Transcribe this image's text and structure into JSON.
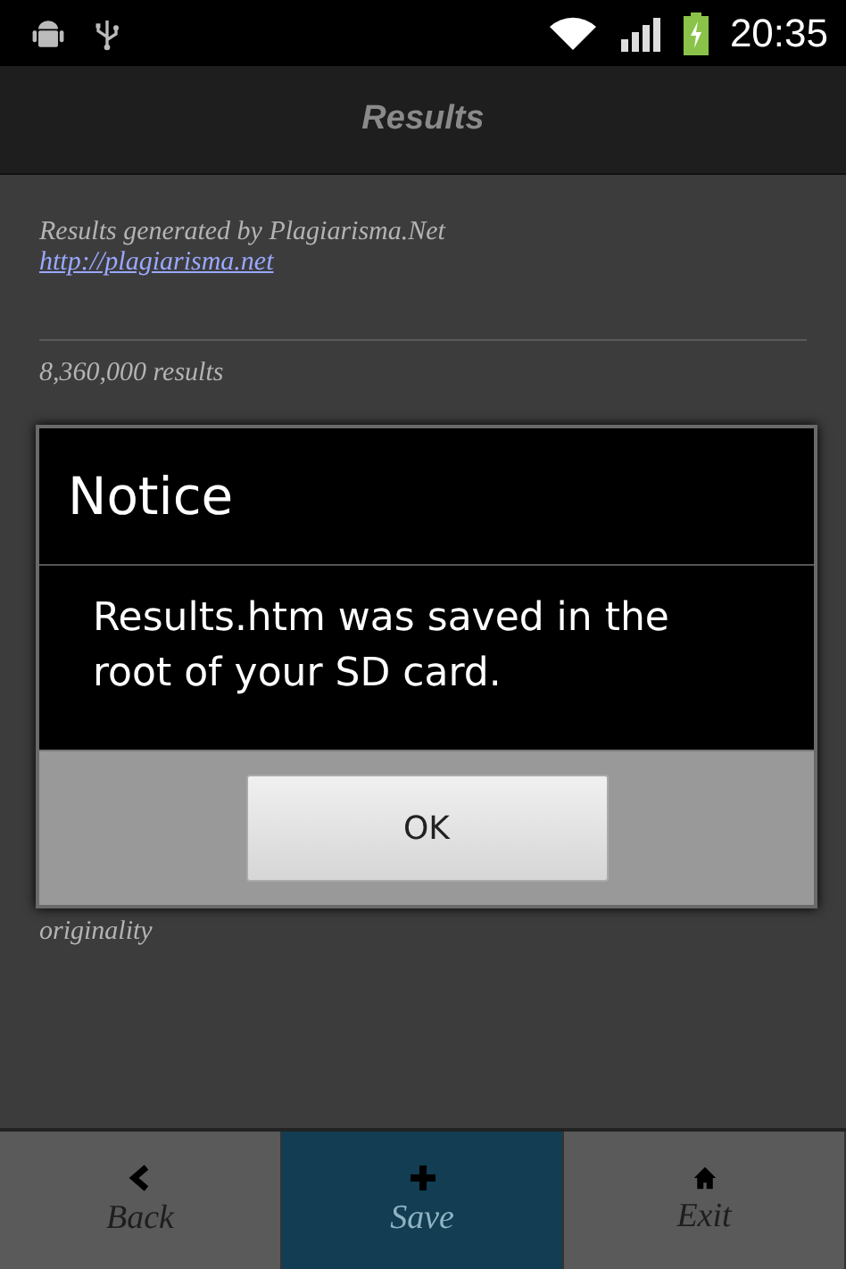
{
  "status_bar": {
    "time": "20:35"
  },
  "title_bar": {
    "title": "Results"
  },
  "content": {
    "credit": "Results generated by Plagiarisma.Net",
    "link": "http://plagiarisma.net",
    "count": "8,360,000 results",
    "trailing_text": "originality"
  },
  "dialog": {
    "title": "Notice",
    "message": "Results.htm was saved in the root of your SD card.",
    "buttons": [
      "OK"
    ]
  },
  "tabs": [
    {
      "kind": "back",
      "label": "Back",
      "selected": false
    },
    {
      "kind": "plus",
      "label": "Save",
      "selected": true
    },
    {
      "kind": "home",
      "label": "Exit",
      "selected": false
    }
  ]
}
